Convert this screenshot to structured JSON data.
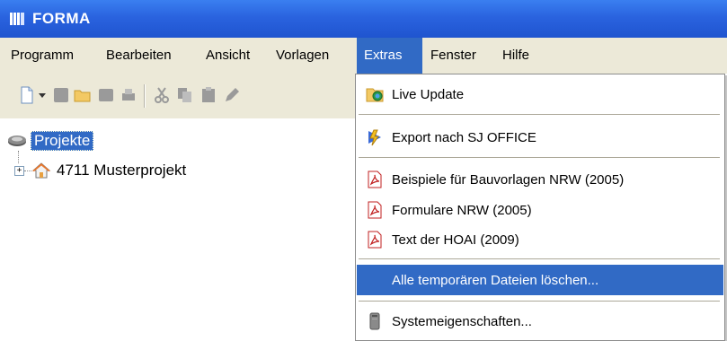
{
  "window": {
    "title": "FORMA"
  },
  "menubar": {
    "items": [
      "Programm",
      "Bearbeiten",
      "Ansicht",
      "Vorlagen",
      "Extras",
      "Fenster",
      "Hilfe"
    ],
    "active": "Extras"
  },
  "tree": {
    "root": "Projekte",
    "children": [
      "4711 Musterprojekt"
    ]
  },
  "extras_menu": {
    "items": [
      {
        "label": "Live Update",
        "icon": "live-update-icon"
      },
      {
        "label": "Export nach SJ OFFICE",
        "icon": "export-icon"
      },
      {
        "label": "Beispiele für Bauvorlagen NRW (2005)",
        "icon": "pdf-icon"
      },
      {
        "label": "Formulare NRW (2005)",
        "icon": "pdf-icon"
      },
      {
        "label": "Text der HOAI (2009)",
        "icon": "pdf-icon"
      },
      {
        "label": "Alle temporären Dateien löschen...",
        "icon": ""
      },
      {
        "label": "Systemeigenschaften...",
        "icon": "system-icon"
      }
    ],
    "highlighted": "Alle temporären Dateien löschen..."
  },
  "colors": {
    "titlebar": "#2a63df",
    "highlight": "#316ac5",
    "menubar": "#ece9d8"
  }
}
